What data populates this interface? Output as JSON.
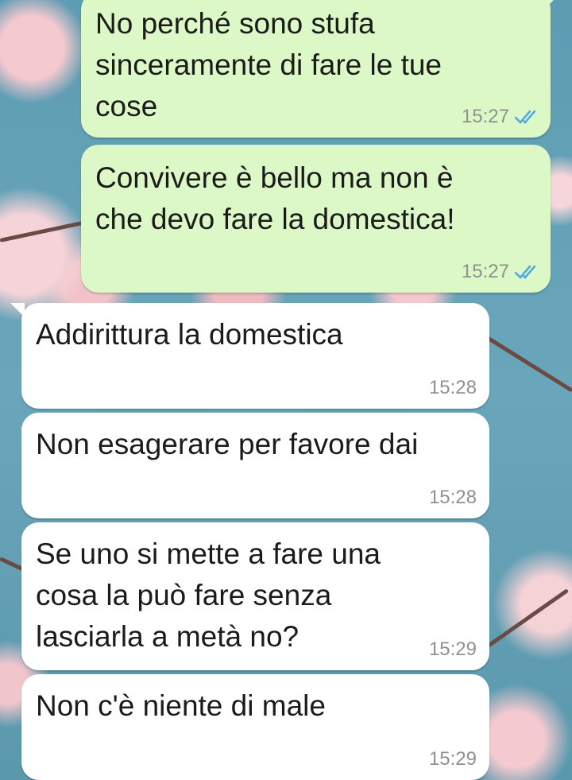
{
  "chat": {
    "messages": [
      {
        "direction": "outgoing",
        "text": "No perché sono stufa\nsinceramente di fare le tue\ncose",
        "time": "15:27",
        "status": "read"
      },
      {
        "direction": "outgoing",
        "text": "Convivere è bello ma non è\nche devo fare la domestica!",
        "time": "15:27",
        "status": "read"
      },
      {
        "direction": "incoming",
        "text": "Addirittura la domestica",
        "time": "15:28"
      },
      {
        "direction": "incoming",
        "text": "Non esagerare per favore dai",
        "time": "15:28"
      },
      {
        "direction": "incoming",
        "text": "Se uno si mette a fare una\ncosa la può fare senza\nlasciarla a metà no?",
        "time": "15:29"
      },
      {
        "direction": "incoming",
        "text": "Non c'è niente di male",
        "time": "15:29"
      }
    ]
  },
  "colors": {
    "outgoing_bubble": "#dcf8c6",
    "incoming_bubble": "#ffffff",
    "read_ticks": "#4fa9e6",
    "timestamp": "#909090"
  }
}
